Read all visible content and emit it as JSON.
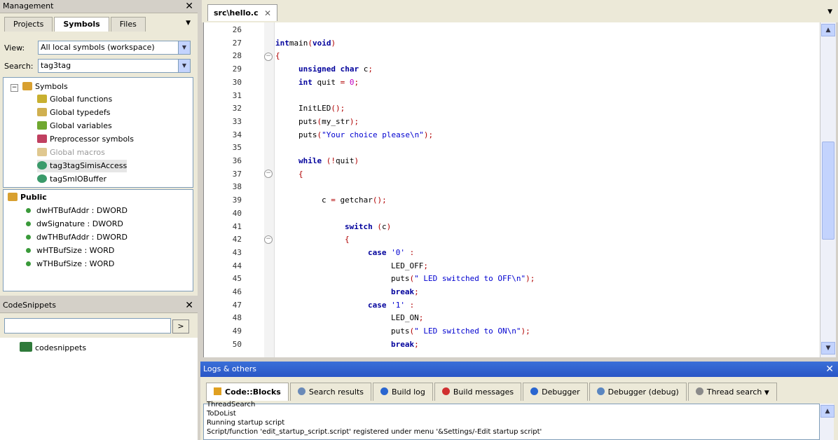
{
  "management": {
    "title": "Management",
    "tabs": [
      "Projects",
      "Symbols",
      "Files"
    ],
    "active_tab": "Symbols",
    "view_label": "View:",
    "view_value": "All local symbols (workspace)",
    "search_label": "Search:",
    "search_value": "tag3tag",
    "tree_root": "Symbols",
    "tree_items": [
      "Global functions",
      "Global typedefs",
      "Global variables",
      "Preprocessor symbols",
      "Global macros",
      "tag3tagSimisAccess",
      "tagSmIOBuffer"
    ],
    "public_label": "Public",
    "members": [
      "dwHTBufAddr : DWORD",
      "dwSignature : DWORD",
      "dwTHBufAddr : DWORD",
      "wHTBufSize : WORD",
      "wTHBufSize : WORD"
    ]
  },
  "codesnippets": {
    "title": "CodeSnippets",
    "search_value": "",
    "go_button": ">",
    "root": "codesnippets"
  },
  "editor": {
    "tab_label": "src\\hello.c",
    "lines": [
      {
        "n": "26",
        "indent": 0,
        "segs": []
      },
      {
        "n": "27",
        "indent": 0,
        "segs": [
          [
            "kw",
            "int"
          ],
          [
            "",
            "main"
          ],
          [
            "op",
            "("
          ],
          [
            "kw",
            "void"
          ],
          [
            "op",
            ")"
          ]
        ]
      },
      {
        "n": "28",
        "indent": 0,
        "segs": [
          [
            "op",
            "{"
          ]
        ]
      },
      {
        "n": "29",
        "indent": 1,
        "segs": [
          [
            "kw",
            "unsigned char"
          ],
          [
            "",
            " c"
          ],
          [
            "op",
            ";"
          ]
        ]
      },
      {
        "n": "30",
        "indent": 1,
        "segs": [
          [
            "kw",
            "int"
          ],
          [
            "",
            " quit "
          ],
          [
            "op",
            "="
          ],
          [
            "",
            " "
          ],
          [
            "num",
            "0"
          ],
          [
            "op",
            ";"
          ]
        ]
      },
      {
        "n": "31",
        "indent": 0,
        "segs": []
      },
      {
        "n": "32",
        "indent": 1,
        "segs": [
          [
            "",
            "InitLED"
          ],
          [
            "op",
            "();"
          ]
        ]
      },
      {
        "n": "33",
        "indent": 1,
        "segs": [
          [
            "",
            "puts"
          ],
          [
            "op",
            "("
          ],
          [
            "",
            "my_str"
          ],
          [
            "op",
            ");"
          ]
        ]
      },
      {
        "n": "34",
        "indent": 1,
        "segs": [
          [
            "",
            "puts"
          ],
          [
            "op",
            "("
          ],
          [
            "str",
            "\"Your choice please\\n\""
          ],
          [
            "op",
            ");"
          ]
        ]
      },
      {
        "n": "35",
        "indent": 0,
        "segs": []
      },
      {
        "n": "36",
        "indent": 1,
        "segs": [
          [
            "kw",
            "while"
          ],
          [
            "",
            " "
          ],
          [
            "op",
            "(!"
          ],
          [
            "",
            "quit"
          ],
          [
            "op",
            ")"
          ]
        ]
      },
      {
        "n": "37",
        "indent": 1,
        "segs": [
          [
            "op",
            "{"
          ]
        ]
      },
      {
        "n": "38",
        "indent": 0,
        "segs": []
      },
      {
        "n": "39",
        "indent": 2,
        "segs": [
          [
            "",
            "c "
          ],
          [
            "op",
            "="
          ],
          [
            "",
            " getchar"
          ],
          [
            "op",
            "();"
          ]
        ]
      },
      {
        "n": "40",
        "indent": 0,
        "segs": []
      },
      {
        "n": "41",
        "indent": 3,
        "segs": [
          [
            "kw",
            "switch"
          ],
          [
            "",
            " "
          ],
          [
            "op",
            "("
          ],
          [
            "",
            "c"
          ],
          [
            "op",
            ")"
          ]
        ]
      },
      {
        "n": "42",
        "indent": 3,
        "segs": [
          [
            "op",
            "{"
          ]
        ]
      },
      {
        "n": "43",
        "indent": 4,
        "segs": [
          [
            "kw",
            "case"
          ],
          [
            "",
            " "
          ],
          [
            "str",
            "'0'"
          ],
          [
            "",
            " "
          ],
          [
            "op",
            ":"
          ]
        ]
      },
      {
        "n": "44",
        "indent": 5,
        "segs": [
          [
            "",
            "LED_OFF"
          ],
          [
            "op",
            ";"
          ]
        ]
      },
      {
        "n": "45",
        "indent": 5,
        "segs": [
          [
            "",
            "puts"
          ],
          [
            "op",
            "("
          ],
          [
            "str",
            "\" LED switched to OFF\\n\""
          ],
          [
            "op",
            ");"
          ]
        ]
      },
      {
        "n": "46",
        "indent": 5,
        "segs": [
          [
            "kw",
            "break"
          ],
          [
            "op",
            ";"
          ]
        ]
      },
      {
        "n": "47",
        "indent": 4,
        "segs": [
          [
            "kw",
            "case"
          ],
          [
            "",
            " "
          ],
          [
            "str",
            "'1'"
          ],
          [
            "",
            " "
          ],
          [
            "op",
            ":"
          ]
        ]
      },
      {
        "n": "48",
        "indent": 5,
        "segs": [
          [
            "",
            "LED_ON"
          ],
          [
            "op",
            ";"
          ]
        ]
      },
      {
        "n": "49",
        "indent": 5,
        "segs": [
          [
            "",
            "puts"
          ],
          [
            "op",
            "("
          ],
          [
            "str",
            "\" LED switched to ON\\n\""
          ],
          [
            "op",
            ");"
          ]
        ]
      },
      {
        "n": "50",
        "indent": 5,
        "segs": [
          [
            "kw",
            "break"
          ],
          [
            "op",
            ";"
          ]
        ]
      }
    ]
  },
  "logs": {
    "title": "Logs & others",
    "tabs": [
      "Code::Blocks",
      "Search results",
      "Build log",
      "Build messages",
      "Debugger",
      "Debugger (debug)",
      "Thread search"
    ],
    "active_tab": "Code::Blocks",
    "lines": [
      "ThreadSearch",
      "ToDoList",
      "Running startup script",
      "Script/function 'edit_startup_script.script' registered under menu '&Settings/-Edit startup script'"
    ]
  },
  "colors": {
    "accent": "#2a56c6",
    "keyword": "#00009c",
    "operator": "#b00000",
    "string": "#0000d0"
  }
}
